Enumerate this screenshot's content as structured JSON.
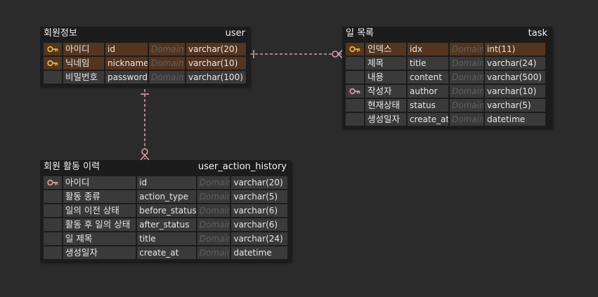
{
  "colors": {
    "background": "#2b2b2b",
    "entity_bg": "#1c1c1c",
    "cell_bg": "#3a3a3a",
    "pk_row_bg": "#55351f",
    "pk_key_icon": "#e0b341",
    "fk_key_icon": "#d99aa3",
    "relation_line": "#d99aa3"
  },
  "entities": {
    "user": {
      "logical_name": "회원정보",
      "physical_name": "user",
      "columns": [
        {
          "logical": "아이디",
          "physical": "id",
          "domain": "Domain",
          "type": "varchar(20)",
          "key": "pk"
        },
        {
          "logical": "닉네임",
          "physical": "nickname",
          "domain": "Domain",
          "type": "varchar(10)",
          "key": "pk"
        },
        {
          "logical": "비밀번호",
          "physical": "password",
          "domain": "Domain",
          "type": "varchar(100)",
          "key": ""
        }
      ]
    },
    "task": {
      "logical_name": "일 목록",
      "physical_name": "task",
      "columns": [
        {
          "logical": "인덱스",
          "physical": "idx",
          "domain": "Domain",
          "type": "int(11)",
          "key": "pk"
        },
        {
          "logical": "제목",
          "physical": "title",
          "domain": "Domain",
          "type": "varchar(24)",
          "key": ""
        },
        {
          "logical": "내용",
          "physical": "content",
          "domain": "Domain",
          "type": "varchar(500)",
          "key": ""
        },
        {
          "logical": "작성자",
          "physical": "author",
          "domain": "Domain",
          "type": "varchar(10)",
          "key": "fk"
        },
        {
          "logical": "현재상태",
          "physical": "status",
          "domain": "Domain",
          "type": "varchar(5)",
          "key": ""
        },
        {
          "logical": "생성일자",
          "physical": "create_at",
          "domain": "Domain",
          "type": "datetime",
          "key": ""
        }
      ]
    },
    "history": {
      "logical_name": "회원 활동 이력",
      "physical_name": "user_action_history",
      "columns": [
        {
          "logical": "아이디",
          "physical": "id",
          "domain": "Domain",
          "type": "varchar(20)",
          "key": "fk"
        },
        {
          "logical": "활동 종류",
          "physical": "action_type",
          "domain": "Domain",
          "type": "varchar(5)",
          "key": ""
        },
        {
          "logical": "일의 이전 상태",
          "physical": "before_status",
          "domain": "Domain",
          "type": "varchar(6)",
          "key": ""
        },
        {
          "logical": "활동 후 일의 상태",
          "physical": "after_status",
          "domain": "Domain",
          "type": "varchar(6)",
          "key": ""
        },
        {
          "logical": "일 제목",
          "physical": "title",
          "domain": "Domain",
          "type": "varchar(24)",
          "key": ""
        },
        {
          "logical": "생성일자",
          "physical": "create_at",
          "domain": "Domain",
          "type": "datetime",
          "key": ""
        }
      ]
    }
  },
  "relationships": [
    {
      "from": "user",
      "to": "task",
      "notation": "one-to-zero-or-many"
    },
    {
      "from": "user",
      "to": "history",
      "notation": "one-to-zero-or-many"
    }
  ]
}
